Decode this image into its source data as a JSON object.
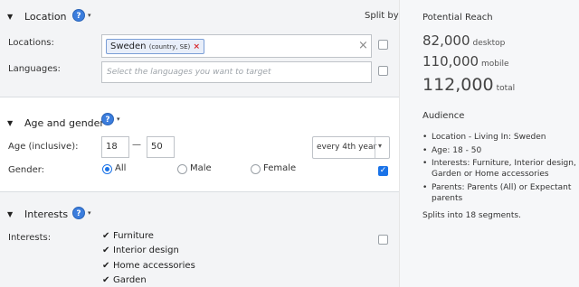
{
  "location": {
    "title": "Location",
    "split_by": "Split by",
    "locations_label": "Locations:",
    "token_main": "Sweden",
    "token_detail": "(country, SE)",
    "token_remove": "×",
    "clear": "×",
    "languages_label": "Languages:",
    "languages_placeholder": "Select the languages you want to target"
  },
  "age_gender": {
    "title": "Age and gender",
    "age_label": "Age (inclusive):",
    "age_min": "18",
    "dash": "—",
    "age_max": "50",
    "split_option": "every 4th year",
    "gender_label": "Gender:",
    "genders": [
      "All",
      "Male",
      "Female"
    ],
    "gender_selected": "All",
    "split_checked": true
  },
  "interests": {
    "title": "Interests",
    "label": "Interests:",
    "items": [
      "Furniture",
      "Interior design",
      "Home accessories",
      "Garden"
    ],
    "check_glyph": "✔"
  },
  "reach": {
    "title": "Potential Reach",
    "desktop_value": "82,000",
    "desktop_unit": "desktop",
    "mobile_value": "110,000",
    "mobile_unit": "mobile",
    "total_value": "112,000",
    "total_unit": "total"
  },
  "audience": {
    "title": "Audience",
    "bullet": "•",
    "items": [
      "Location - Living In: Sweden",
      "Age: 18 - 50",
      "Interests: Furniture, Interior design, Garden or Home accessories",
      "Parents: Parents (All) or Expectant parents"
    ],
    "splits_note": "Splits into 18 segments."
  },
  "icons": {
    "caret_glyph": "▼",
    "small_caret_glyph": "▾",
    "help_glyph": "?",
    "accent": "#1a73e8"
  }
}
